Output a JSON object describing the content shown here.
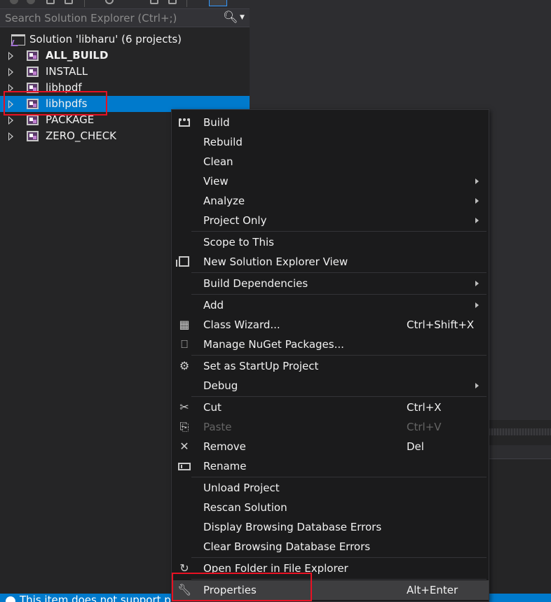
{
  "solution_explorer": {
    "search_placeholder": "Search Solution Explorer (Ctrl+;)",
    "search_icon": "search-icon",
    "solution_label": "Solution 'libharu' (6 projects)",
    "projects": [
      {
        "label": "ALL_BUILD",
        "bold": true
      },
      {
        "label": "INSTALL",
        "bold": false
      },
      {
        "label": "libhpdf",
        "bold": false
      },
      {
        "label": "libhpdfs",
        "bold": false,
        "selected": true
      },
      {
        "label": "PACKAGE",
        "bold": false
      },
      {
        "label": "ZERO_CHECK",
        "bold": false
      }
    ]
  },
  "context_menu": {
    "items": [
      {
        "label": "Build",
        "icon": "build-icon"
      },
      {
        "label": "Rebuild"
      },
      {
        "label": "Clean"
      },
      {
        "label": "View",
        "submenu": true
      },
      {
        "label": "Analyze",
        "submenu": true
      },
      {
        "label": "Project Only",
        "submenu": true
      },
      {
        "label": "Scope to This"
      },
      {
        "label": "New Solution Explorer View",
        "icon": "new-view-icon"
      },
      {
        "label": "Build Dependencies",
        "submenu": true
      },
      {
        "label": "Add",
        "submenu": true
      },
      {
        "label": "Class Wizard...",
        "shortcut": "Ctrl+Shift+X",
        "icon": "class-wizard-icon"
      },
      {
        "label": "Manage NuGet Packages...",
        "icon": "nuget-icon"
      },
      {
        "label": "Set as StartUp Project",
        "icon": "gear-icon"
      },
      {
        "label": "Debug",
        "submenu": true
      },
      {
        "label": "Cut",
        "shortcut": "Ctrl+X",
        "icon": "scissors-icon"
      },
      {
        "label": "Paste",
        "shortcut": "Ctrl+V",
        "icon": "paste-icon",
        "disabled": true
      },
      {
        "label": "Remove",
        "shortcut": "Del",
        "icon": "remove-icon"
      },
      {
        "label": "Rename",
        "icon": "rename-icon"
      },
      {
        "label": "Unload Project"
      },
      {
        "label": "Rescan Solution"
      },
      {
        "label": "Display Browsing Database Errors"
      },
      {
        "label": "Clear Browsing Database Errors"
      },
      {
        "label": "Open Folder in File Explorer",
        "icon": "refresh-icon"
      },
      {
        "label": "Properties",
        "shortcut": "Alt+Enter",
        "icon": "wrench-icon",
        "highlighted": true
      }
    ]
  },
  "status_bar": {
    "text": "This item does not support previewing"
  },
  "colors": {
    "accent": "#007acc",
    "highlight_box": "#e81123",
    "menu_bg": "#1b1b1c",
    "panel_bg": "#252526"
  }
}
